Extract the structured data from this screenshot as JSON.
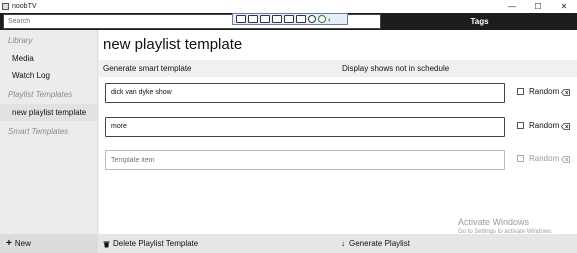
{
  "window": {
    "title": "noobTV",
    "controls": [
      "minimize",
      "maximize",
      "close"
    ]
  },
  "header": {
    "search_placeholder": "Search",
    "tags_tab": "Tags"
  },
  "sidebar": {
    "sections": [
      {
        "heading": "Library",
        "items": [
          "Media",
          "Watch Log"
        ]
      },
      {
        "heading": "Playlist Templates",
        "items": [
          "new playlist template"
        ]
      },
      {
        "heading": "Smart Templates",
        "items": []
      }
    ],
    "new_button": "New"
  },
  "main": {
    "title": "new playlist template",
    "actions": {
      "generate_smart": "Generate smart template",
      "display_shows": "Display shows not in schedule"
    },
    "rows": [
      {
        "value": "dick van dyke show",
        "random_label": "Random"
      },
      {
        "value": "more",
        "random_label": "Random"
      },
      {
        "placeholder": "Template item",
        "random_label": "Random"
      }
    ],
    "delete_template": "Delete Playlist Template",
    "generate_playlist": "Generate Playlist"
  },
  "watermark": {
    "line1": "Activate Windows",
    "line2": "Go to Settings to activate Windows."
  }
}
